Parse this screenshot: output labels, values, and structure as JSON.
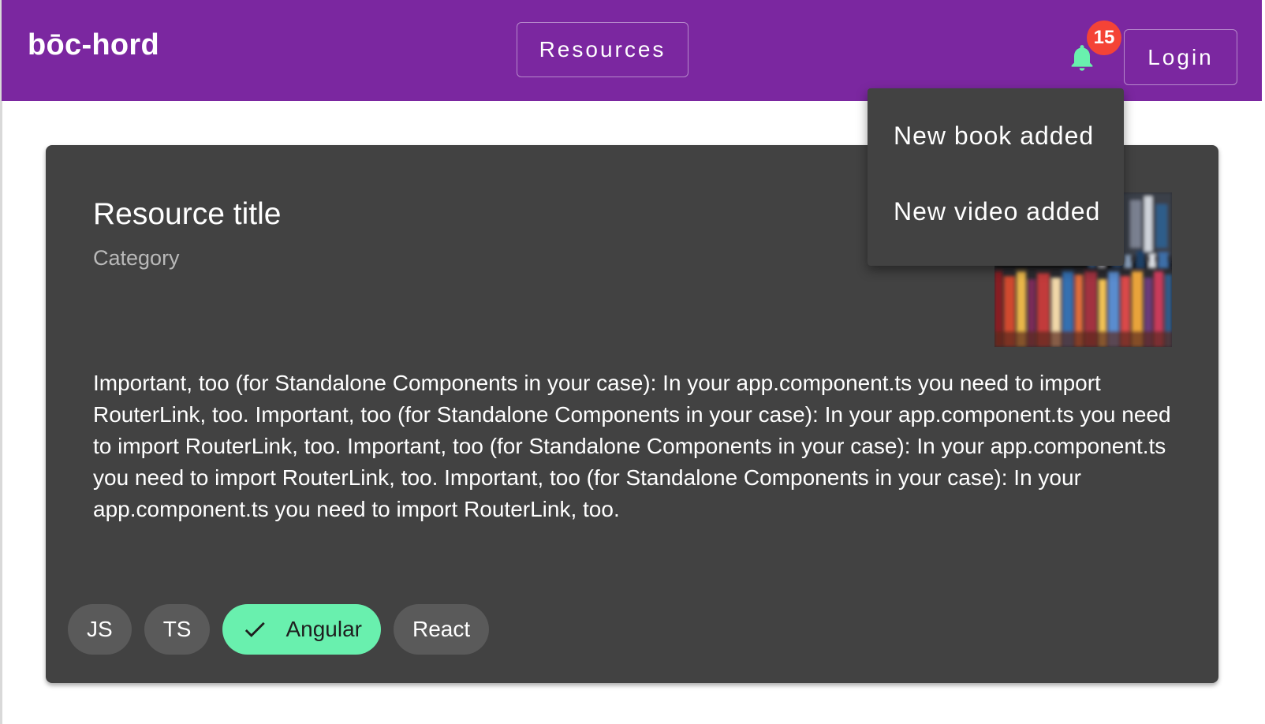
{
  "app": {
    "brand": "bōc-hord",
    "primary_color": "#7b27a0"
  },
  "header": {
    "nav_resources": "Resources",
    "login": "Login",
    "notifications": {
      "icon": "bell-icon",
      "count": "15",
      "badge_color": "#f44336",
      "icon_color": "#69f0ae"
    }
  },
  "notification_menu": {
    "items": [
      {
        "label": "New book added"
      },
      {
        "label": "New video added"
      }
    ]
  },
  "card": {
    "title": "Resource title",
    "subtitle": "Category",
    "image": "bookshelf-photo",
    "body": "Important, too (for Standalone Components in your case): In your app.component.ts you need to import RouterLink, too. Important, too (for Standalone Components in your case): In your app.component.ts you need to import RouterLink, too. Important, too (for Standalone Components in your case): In your app.component.ts you need to import RouterLink, too. Important, too (for Standalone Components in your case): In your app.component.ts you need to import RouterLink, too.",
    "chips": [
      {
        "label": "JS",
        "selected": false
      },
      {
        "label": "TS",
        "selected": false
      },
      {
        "label": "Angular",
        "selected": true,
        "icon": "check-icon"
      },
      {
        "label": "React",
        "selected": false
      }
    ],
    "selected_chip_color": "#69f0ae"
  }
}
